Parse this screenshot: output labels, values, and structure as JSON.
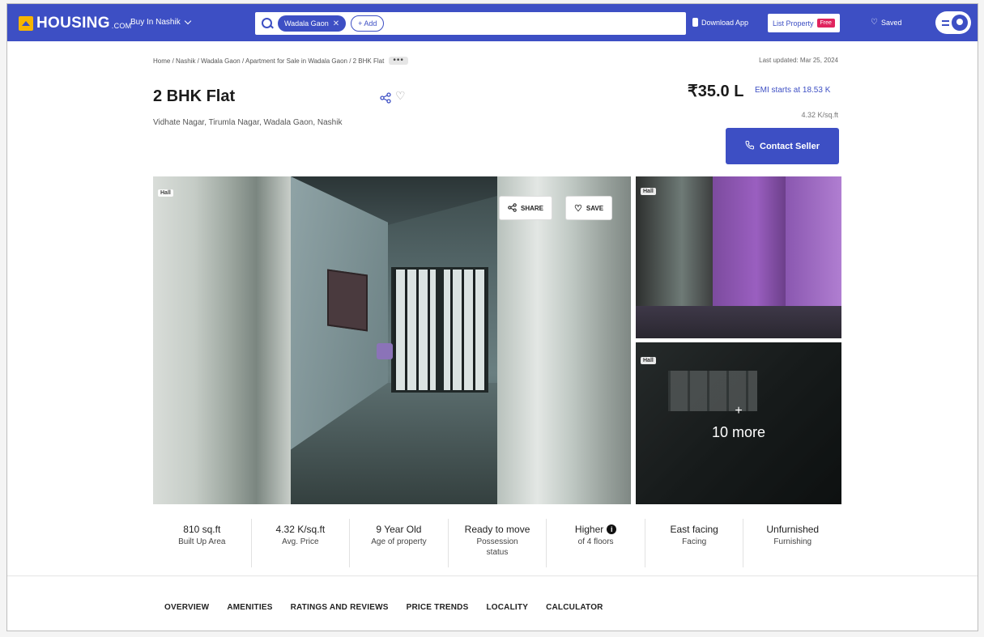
{
  "nav": {
    "logo_text": "HOUSING",
    "logo_sub": ".COM",
    "city_label": "Buy In Nashik",
    "search_chip": "Wadala Gaon",
    "add_label": "+ Add",
    "download_label": "Download App",
    "list_property_label": "List Property",
    "free_badge": "Free",
    "saved_label": "Saved",
    "brand_color": "#3d4fc4"
  },
  "breadcrumb": {
    "items": [
      "Home",
      "Nashik",
      "Wadala Gaon",
      "Apartment for Sale in Wadala Gaon",
      "2 BHK Flat"
    ],
    "text": "Home / Nashik / Wadala Gaon / Apartment for Sale in Wadala Gaon / 2 BHK Flat",
    "more": "•••"
  },
  "last_updated": "Last updated: Mar 25, 2024",
  "listing": {
    "title": "2 BHK Flat",
    "address": "Vidhate Nagar, Tirumla Nagar, Wadala Gaon, Nashik",
    "price": "₹35.0 L",
    "emi": "EMI starts at  18.53 K",
    "per_sqft": "4.32 K/sq.ft",
    "contact_label": "Contact Seller"
  },
  "gallery": {
    "main_tag": "Hall",
    "share_label": "SHARE",
    "save_label": "SAVE",
    "side1_tag": "Hall",
    "side2_tag": "Hall",
    "more_plus": "+",
    "more_text": "10 more"
  },
  "stats": [
    {
      "value": "810 sq.ft",
      "label": "Built Up Area"
    },
    {
      "value": "4.32 K/sq.ft",
      "label": "Avg. Price"
    },
    {
      "value": "9 Year Old",
      "label": "Age of property"
    },
    {
      "value": "Ready to move",
      "label": "Possession status"
    },
    {
      "value": "Higher",
      "label": "of 4 floors"
    },
    {
      "value": "East facing",
      "label": "Facing"
    },
    {
      "value": "Unfurnished",
      "label": "Furnishing"
    }
  ],
  "tabs": [
    "OVERVIEW",
    "AMENITIES",
    "RATINGS AND REVIEWS",
    "PRICE TRENDS",
    "LOCALITY",
    "CALCULATOR"
  ]
}
